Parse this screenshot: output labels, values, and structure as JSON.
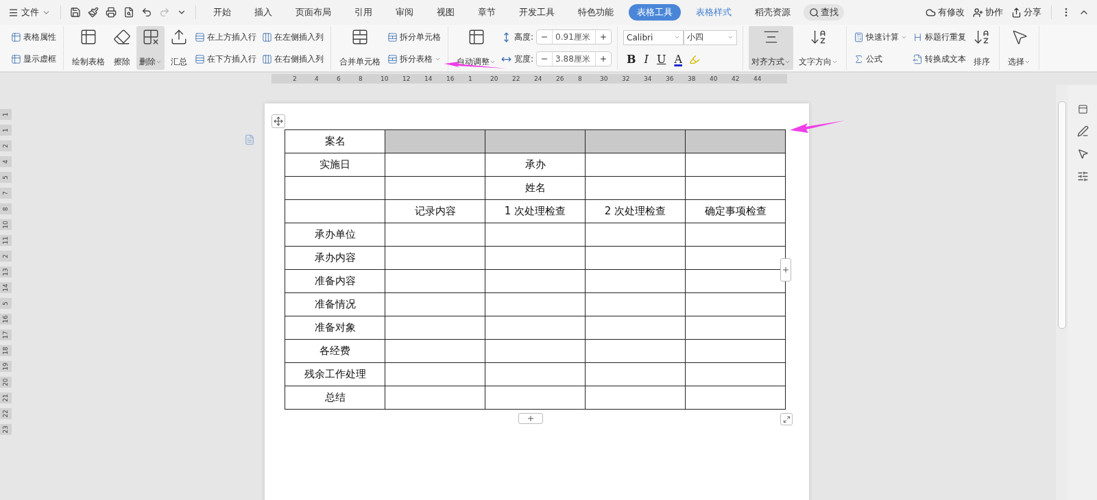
{
  "file_menu": {
    "label": "文件"
  },
  "tabs": [
    {
      "label": "开始",
      "kind": "normal",
      "selected": false
    },
    {
      "label": "插入",
      "kind": "normal",
      "selected": false
    },
    {
      "label": "页面布局",
      "kind": "normal",
      "selected": false
    },
    {
      "label": "引用",
      "kind": "normal",
      "selected": false
    },
    {
      "label": "审阅",
      "kind": "normal",
      "selected": false
    },
    {
      "label": "视图",
      "kind": "normal",
      "selected": false
    },
    {
      "label": "章节",
      "kind": "normal",
      "selected": false
    },
    {
      "label": "开发工具",
      "kind": "normal",
      "selected": false
    },
    {
      "label": "特色功能",
      "kind": "normal",
      "selected": false
    },
    {
      "label": "表格工具",
      "kind": "context",
      "selected": true
    },
    {
      "label": "表格样式",
      "kind": "context",
      "selected": false
    },
    {
      "label": "稻壳资源",
      "kind": "normal",
      "selected": false
    }
  ],
  "search": {
    "label": "查找"
  },
  "top_actions": [
    {
      "label": "有修改"
    },
    {
      "label": "协作"
    },
    {
      "label": "分享"
    }
  ],
  "ribbon": {
    "groups": [
      {
        "items": [
          {
            "kind": "stack",
            "items": [
              {
                "label": "表格属性",
                "dropdown": false
              },
              {
                "label": "显示虚框",
                "dropdown": false
              }
            ]
          }
        ]
      },
      {
        "items": [
          {
            "kind": "large",
            "label": "绘制表格",
            "pressed": false,
            "dropdown": false
          },
          {
            "kind": "large",
            "label": "擦除",
            "pressed": false,
            "dropdown": false
          },
          {
            "kind": "large",
            "label": "删除",
            "pressed": true,
            "dropdown": true
          },
          {
            "kind": "large",
            "label": "汇总",
            "pressed": false,
            "dropdown": false
          },
          {
            "kind": "stack",
            "items": [
              {
                "label": "在上方插入行",
                "dropdown": false
              },
              {
                "label": "在下方插入行",
                "dropdown": false
              }
            ]
          },
          {
            "kind": "stack",
            "items": [
              {
                "label": "在左侧插入列",
                "dropdown": false
              },
              {
                "label": "在右侧插入列",
                "dropdown": false
              }
            ]
          }
        ]
      },
      {
        "items": [
          {
            "kind": "large",
            "label": "合并单元格",
            "pressed": false,
            "dropdown": false
          },
          {
            "kind": "stack",
            "items": [
              {
                "label": "拆分单元格",
                "dropdown": false
              },
              {
                "label": "拆分表格",
                "dropdown": true
              }
            ]
          }
        ]
      },
      {
        "items": [
          {
            "kind": "large",
            "label": "自动调整",
            "pressed": false,
            "dropdown": true
          },
          {
            "kind": "dimensions",
            "items": [
              {
                "label": "高度:",
                "value": "0.91厘米"
              },
              {
                "label": "宽度:",
                "value": "3.88厘米"
              }
            ]
          }
        ]
      },
      {
        "items": [
          {
            "kind": "font",
            "font": "Calibri",
            "size": "小四",
            "buttons": [
              {
                "kind": "bold",
                "label": "B"
              },
              {
                "kind": "italic",
                "label": "I"
              },
              {
                "kind": "underline",
                "label": "U"
              },
              {
                "kind": "color",
                "label": "A"
              },
              {
                "kind": "highlight"
              }
            ]
          }
        ]
      },
      {
        "items": [
          {
            "kind": "large",
            "label": "对齐方式",
            "pressed": true,
            "dropdown": true
          },
          {
            "kind": "large",
            "label": "文字方向",
            "pressed": false,
            "dropdown": true
          }
        ]
      },
      {
        "items": [
          {
            "kind": "stack",
            "items": [
              {
                "label": "快速计算",
                "dropdown": true
              },
              {
                "label": "公式",
                "dropdown": false
              }
            ]
          },
          {
            "kind": "stack",
            "items": [
              {
                "label": "标题行重复",
                "dropdown": false
              },
              {
                "label": "转换成文本",
                "dropdown": false
              }
            ]
          },
          {
            "kind": "large",
            "label": "排序",
            "pressed": false,
            "dropdown": false
          }
        ]
      },
      {
        "items": [
          {
            "kind": "large",
            "label": "选择",
            "pressed": false,
            "dropdown": true
          }
        ]
      }
    ]
  },
  "ruler": {
    "labels": [
      "2",
      "4",
      "6",
      "8",
      "10",
      "12",
      "14",
      "16",
      "1",
      "20",
      "22",
      "24",
      "26",
      "8",
      "30",
      "32",
      "34",
      "36",
      "38",
      "40",
      "42",
      "44"
    ]
  },
  "vertical_ruler": {
    "labels": [
      "1",
      "1",
      "2",
      "4",
      "5",
      "7",
      "8",
      "10",
      "11",
      "2",
      "13",
      "14",
      "5",
      "16",
      "17",
      "18",
      "19",
      "20",
      "21",
      "22",
      "23"
    ]
  },
  "table": {
    "rows": [
      {
        "shaded": true,
        "cells": [
          "案名",
          null,
          null,
          null,
          null
        ]
      },
      {
        "shaded": false,
        "cells": [
          "实施日",
          null,
          "承办",
          null,
          null
        ]
      },
      {
        "shaded": false,
        "cells": [
          null,
          null,
          "姓名",
          null,
          null
        ]
      },
      {
        "shaded": false,
        "cells": [
          null,
          "记录内容",
          "1 次处理检查",
          "2 次处理检查",
          "确定事项检查"
        ]
      },
      {
        "shaded": false,
        "cells": [
          "承办单位",
          null,
          null,
          null,
          null
        ]
      },
      {
        "shaded": false,
        "cells": [
          "承办内容",
          null,
          null,
          null,
          null
        ]
      },
      {
        "shaded": false,
        "cells": [
          "准备内容",
          null,
          null,
          null,
          null
        ]
      },
      {
        "shaded": false,
        "cells": [
          "准备情况",
          null,
          null,
          null,
          null
        ]
      },
      {
        "shaded": false,
        "cells": [
          "准备对象",
          null,
          null,
          null,
          null
        ]
      },
      {
        "shaded": false,
        "cells": [
          "各经费",
          null,
          null,
          null,
          null
        ]
      },
      {
        "shaded": false,
        "cells": [
          "残余工作处理",
          null,
          null,
          null,
          null
        ]
      },
      {
        "shaded": false,
        "cells": [
          "总结",
          null,
          null,
          null,
          null
        ]
      }
    ]
  }
}
